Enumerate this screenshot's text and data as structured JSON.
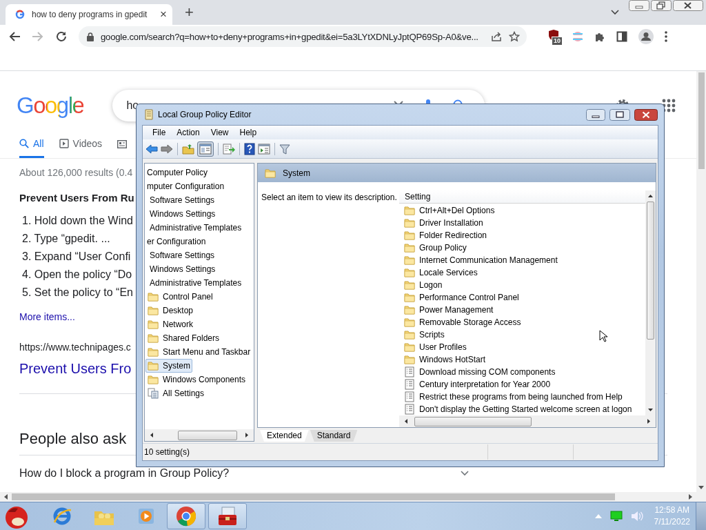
{
  "browser": {
    "tab": {
      "title": "how to deny programs in gpedit",
      "close": "×"
    },
    "new_tab": "+",
    "address": "google.com/search?q=how+to+deny+programs+in+gpedit&ei=5a3LYtXDNLyJptQP69Sp-A0&ve...",
    "extension_badge": "10"
  },
  "google": {
    "logo": "Google",
    "search_value": "ho",
    "tabs": [
      {
        "label": "All",
        "selected": true
      },
      {
        "label": "Videos",
        "selected": false
      }
    ],
    "results_count": "About 126,000 results (0.4",
    "snippet_title": "Prevent Users From Ru",
    "steps": [
      "1. Hold down the Wind",
      "2. Type “gpedit. ...",
      "3. Expand “User Confi",
      "4. Open the policy “Do",
      "5. Set the policy to “En"
    ],
    "more_items": "More items...",
    "result_url": "https://www.technipages.c",
    "result_title": "Prevent Users Fro",
    "people_also_ask": "People also ask",
    "question": "How do I block a program in Group Policy?"
  },
  "gpedit": {
    "title": "Local Group Policy Editor",
    "menu": [
      "File",
      "Action",
      "View",
      "Help"
    ],
    "tree": [
      {
        "label": "Computer Policy",
        "selected": false,
        "children": [
          {
            "label": "mputer Configuration",
            "selected": false,
            "children": [
              {
                "label": "Software Settings",
                "selected": false
              },
              {
                "label": "Windows Settings",
                "selected": false
              },
              {
                "label": "Administrative Templates",
                "selected": false
              }
            ]
          },
          {
            "label": "er Configuration",
            "selected": false,
            "children": [
              {
                "label": "Software Settings",
                "selected": false
              },
              {
                "label": "Windows Settings",
                "selected": false
              },
              {
                "label": "Administrative Templates",
                "selected": false,
                "children": [
                  {
                    "label": "Control Panel",
                    "kind": "folder",
                    "selected": false
                  },
                  {
                    "label": "Desktop",
                    "kind": "folder",
                    "selected": false
                  },
                  {
                    "label": "Network",
                    "kind": "folder",
                    "selected": false
                  },
                  {
                    "label": "Shared Folders",
                    "kind": "folder",
                    "selected": false
                  },
                  {
                    "label": "Start Menu and Taskbar",
                    "kind": "folder",
                    "selected": false
                  },
                  {
                    "label": "System",
                    "kind": "folder",
                    "selected": true
                  },
                  {
                    "label": "Windows Components",
                    "kind": "folder",
                    "selected": false
                  },
                  {
                    "label": "All Settings",
                    "kind": "settings",
                    "selected": false
                  }
                ]
              }
            ]
          }
        ]
      }
    ],
    "pane_title": "System",
    "description": "Select an item to view its description.",
    "column": "Setting",
    "settings": [
      {
        "label": "Ctrl+Alt+Del Options",
        "kind": "folder"
      },
      {
        "label": "Driver Installation",
        "kind": "folder"
      },
      {
        "label": "Folder Redirection",
        "kind": "folder"
      },
      {
        "label": "Group Policy",
        "kind": "folder"
      },
      {
        "label": "Internet Communication Management",
        "kind": "folder"
      },
      {
        "label": "Locale Services",
        "kind": "folder"
      },
      {
        "label": "Logon",
        "kind": "folder"
      },
      {
        "label": "Performance Control Panel",
        "kind": "folder"
      },
      {
        "label": "Power Management",
        "kind": "folder"
      },
      {
        "label": "Removable Storage Access",
        "kind": "folder"
      },
      {
        "label": "Scripts",
        "kind": "folder"
      },
      {
        "label": "User Profiles",
        "kind": "folder"
      },
      {
        "label": "Windows HotStart",
        "kind": "folder"
      },
      {
        "label": "Download missing COM components",
        "kind": "policy"
      },
      {
        "label": "Century interpretation for Year 2000",
        "kind": "policy"
      },
      {
        "label": "Restrict these programs from being launched from Help",
        "kind": "policy"
      },
      {
        "label": "Don't display the Getting Started welcome screen at logon",
        "kind": "policy"
      }
    ],
    "view_tabs": [
      {
        "label": "Extended",
        "selected": true
      },
      {
        "label": "Standard",
        "selected": false
      }
    ],
    "status": "10 setting(s)"
  },
  "taskbar": {
    "time": "12:58 AM",
    "date": "7/11/2022"
  }
}
